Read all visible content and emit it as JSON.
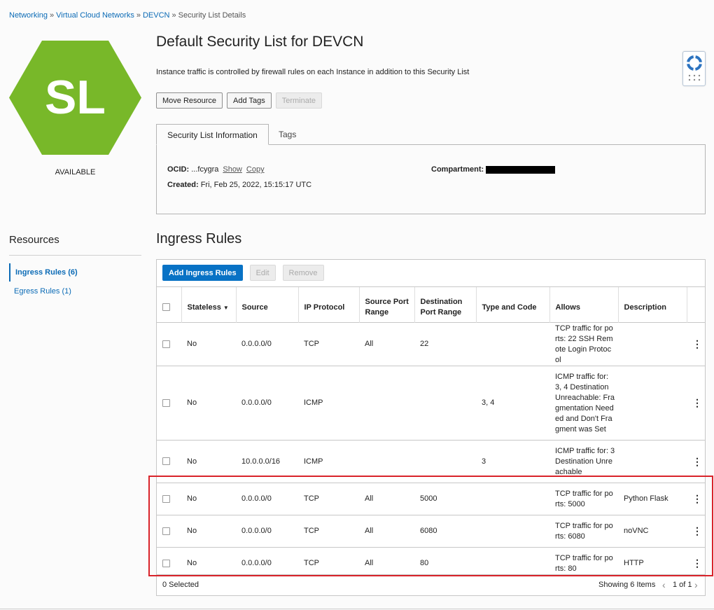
{
  "breadcrumb": {
    "items": [
      "Networking",
      "Virtual Cloud Networks",
      "DEVCN"
    ],
    "current": "Security List Details",
    "separator": "»"
  },
  "resource_badge": {
    "initials": "SL",
    "status": "AVAILABLE",
    "color": "#78b829"
  },
  "header": {
    "title": "Default Security List for DEVCN",
    "subtitle": "Instance traffic is controlled by firewall rules on each Instance in addition to this Security List"
  },
  "actions": {
    "move": "Move Resource",
    "tags": "Add Tags",
    "terminate": "Terminate"
  },
  "tabs": {
    "info": "Security List Information",
    "tags": "Tags"
  },
  "info": {
    "ocid_label": "OCID:",
    "ocid_value": "...fcygra",
    "show": "Show",
    "copy": "Copy",
    "created_label": "Created:",
    "created_value": "Fri, Feb 25, 2022, 15:15:17 UTC",
    "compartment_label": "Compartment:"
  },
  "resources": {
    "title": "Resources",
    "items": [
      {
        "label": "Ingress Rules (6)",
        "active": true
      },
      {
        "label": "Egress Rules (1)",
        "active": false
      }
    ]
  },
  "ingress": {
    "title": "Ingress Rules",
    "add": "Add Ingress Rules",
    "edit": "Edit",
    "remove": "Remove",
    "columns": {
      "stateless": "Stateless",
      "source": "Source",
      "protocol": "IP Protocol",
      "src_port": "Source Port Range",
      "dst_port": "Destination Port Range",
      "type_code": "Type and Code",
      "allows": "Allows",
      "description": "Description"
    },
    "rows": [
      {
        "stateless": "No",
        "source": "0.0.0.0/0",
        "protocol": "TCP",
        "src_port": "All",
        "dst_port": "22",
        "type_code": "",
        "allows": "TCP traffic for ports: 22 SSH Remote Login Protocol",
        "description": ""
      },
      {
        "stateless": "No",
        "source": "0.0.0.0/0",
        "protocol": "ICMP",
        "src_port": "",
        "dst_port": "",
        "type_code": "3, 4",
        "allows": "ICMP traffic for: 3, 4 Destination Unreachable: Fragmentation Needed and Don't Fragment was Set",
        "description": ""
      },
      {
        "stateless": "No",
        "source": "10.0.0.0/16",
        "protocol": "ICMP",
        "src_port": "",
        "dst_port": "",
        "type_code": "3",
        "allows": "ICMP traffic for: 3 Destination Unreachable",
        "description": ""
      },
      {
        "stateless": "No",
        "source": "0.0.0.0/0",
        "protocol": "TCP",
        "src_port": "All",
        "dst_port": "5000",
        "type_code": "",
        "allows": "TCP traffic for ports: 5000",
        "description": "Python Flask"
      },
      {
        "stateless": "No",
        "source": "0.0.0.0/0",
        "protocol": "TCP",
        "src_port": "All",
        "dst_port": "6080",
        "type_code": "",
        "allows": "TCP traffic for ports: 6080",
        "description": "noVNC"
      },
      {
        "stateless": "No",
        "source": "0.0.0.0/0",
        "protocol": "TCP",
        "src_port": "All",
        "dst_port": "80",
        "type_code": "",
        "allows": "TCP traffic for ports: 80",
        "description": "HTTP"
      }
    ],
    "selected": "0 Selected",
    "showing": "Showing 6 Items",
    "pager": "1 of 1"
  }
}
